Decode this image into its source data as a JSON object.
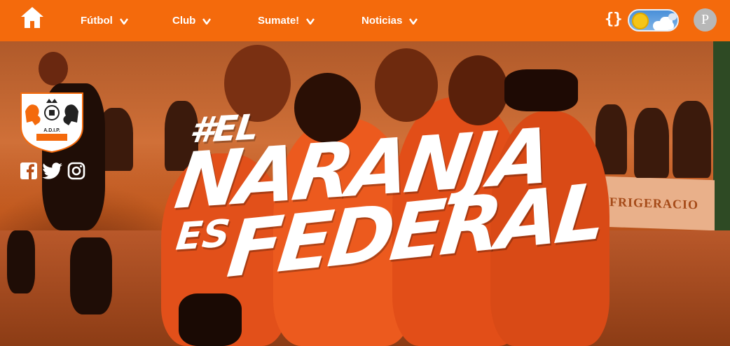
{
  "nav": {
    "items": [
      {
        "label": "Fútbol"
      },
      {
        "label": "Club"
      },
      {
        "label": "Sumate!"
      },
      {
        "label": "Noticias"
      }
    ],
    "theme_toggle_icon": "braces-icon",
    "avatar_initial": "P"
  },
  "hero": {
    "line1": "#EL",
    "line2": "NARANJA",
    "line3": "ES",
    "line4": "FEDERAL",
    "banner_text": "REFRIGERACIO",
    "social": [
      "facebook-icon",
      "twitter-icon",
      "instagram-icon"
    ]
  },
  "colors": {
    "brand": "#f46a0c",
    "text": "#ffffff"
  }
}
